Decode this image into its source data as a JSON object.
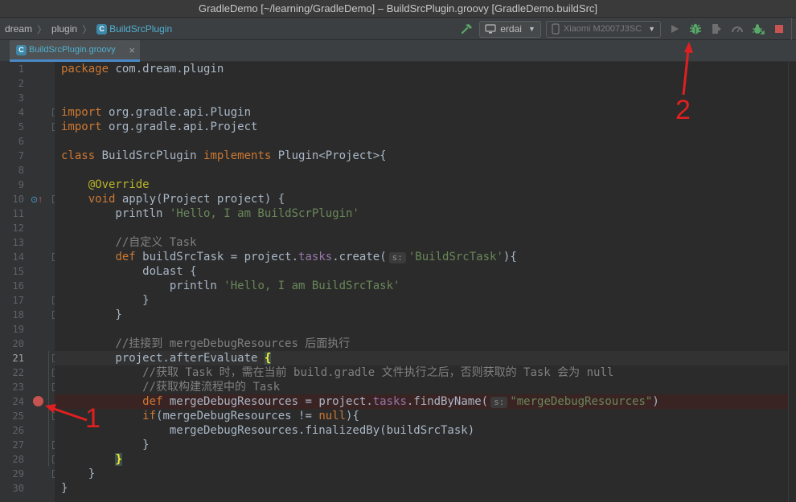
{
  "window": {
    "title": "GradleDemo [~/learning/GradleDemo] – BuildSrcPlugin.groovy [GradleDemo.buildSrc]"
  },
  "navbar": {
    "breadcrumbs": [
      "dream",
      "plugin"
    ],
    "file": "BuildSrcPlugin",
    "config_combo": "erdai",
    "device_combo": "Xiaomi M2007J3SC"
  },
  "toolbar_icons": [
    "hammer-icon",
    "run-icon",
    "debug-icon",
    "coverage-icon",
    "profile-icon",
    "attach-debugger-icon",
    "stop-icon"
  ],
  "tab": {
    "label": "BuildSrcPlugin.groovy",
    "active": true
  },
  "editor": {
    "current_line": 21,
    "breakpoint_line": 24,
    "lines": [
      {
        "n": "1",
        "html": "<span class=\"kw\">package</span> com.dream.plugin"
      },
      {
        "n": "2",
        "html": ""
      },
      {
        "n": "3",
        "html": ""
      },
      {
        "n": "4",
        "html": "<span class=\"kw\">import</span> org.gradle.api.Plugin"
      },
      {
        "n": "5",
        "html": "<span class=\"kw\">import</span> org.gradle.api.Project"
      },
      {
        "n": "6",
        "html": ""
      },
      {
        "n": "7",
        "html": "<span class=\"kw\">class</span> BuildSrcPlugin <span class=\"kw\">implements</span> Plugin&lt;Project&gt;{"
      },
      {
        "n": "8",
        "html": ""
      },
      {
        "n": "9",
        "html": "    <span class=\"ann\">@Override</span>"
      },
      {
        "n": "10",
        "html": "    <span class=\"kw\">void</span> apply(Project project) {"
      },
      {
        "n": "11",
        "html": "        println <span class=\"str\">'Hello, I am BuildScrPlugin'</span>"
      },
      {
        "n": "12",
        "html": ""
      },
      {
        "n": "13",
        "html": "        <span class=\"cmt\">//自定义 Task</span>"
      },
      {
        "n": "14",
        "html": "        <span class=\"kw\">def</span> buildSrcTask = project.<span class=\"prop\">tasks</span>.create(<span class=\"hint\">s:</span><span class=\"str\">'BuildSrcTask'</span>){"
      },
      {
        "n": "15",
        "html": "            doLast {"
      },
      {
        "n": "16",
        "html": "                println <span class=\"str\">'Hello, I am BuildSrcTask'</span>"
      },
      {
        "n": "17",
        "html": "            }"
      },
      {
        "n": "18",
        "html": "        }"
      },
      {
        "n": "19",
        "html": ""
      },
      {
        "n": "20",
        "html": "        <span class=\"cmt\">//挂接到 mergeDebugResources 后面执行</span>"
      },
      {
        "n": "21",
        "html": "        project.afterEvaluate <span class=\"brace-hl\">{</span>"
      },
      {
        "n": "22",
        "html": "            <span class=\"cmt\">//获取 Task 时，需在当前 build.gradle 文件执行之后，否则获取的 Task 会为 null</span>"
      },
      {
        "n": "23",
        "html": "            <span class=\"cmt\">//获取构建流程中的 Task</span>"
      },
      {
        "n": "24",
        "html": "            <span class=\"kw\">def</span> mergeDebugResources = project.<span class=\"prop\">tasks</span>.findByName(<span class=\"hint\">s:</span><span class=\"str\">\"mergeDebugResources\"</span>)"
      },
      {
        "n": "25",
        "html": "            <span class=\"kw\">if</span>(mergeDebugResources != <span class=\"kw\">null</span>){"
      },
      {
        "n": "26",
        "html": "                mergeDebugResources.finalizedBy(buildSrcTask)"
      },
      {
        "n": "27",
        "html": "            }"
      },
      {
        "n": "28",
        "html": "        <span class=\"brace-hl\">}</span>"
      },
      {
        "n": "29",
        "html": "    }"
      },
      {
        "n": "30",
        "html": "}"
      }
    ]
  },
  "annotations": {
    "label_1": "1",
    "label_2": "2"
  }
}
